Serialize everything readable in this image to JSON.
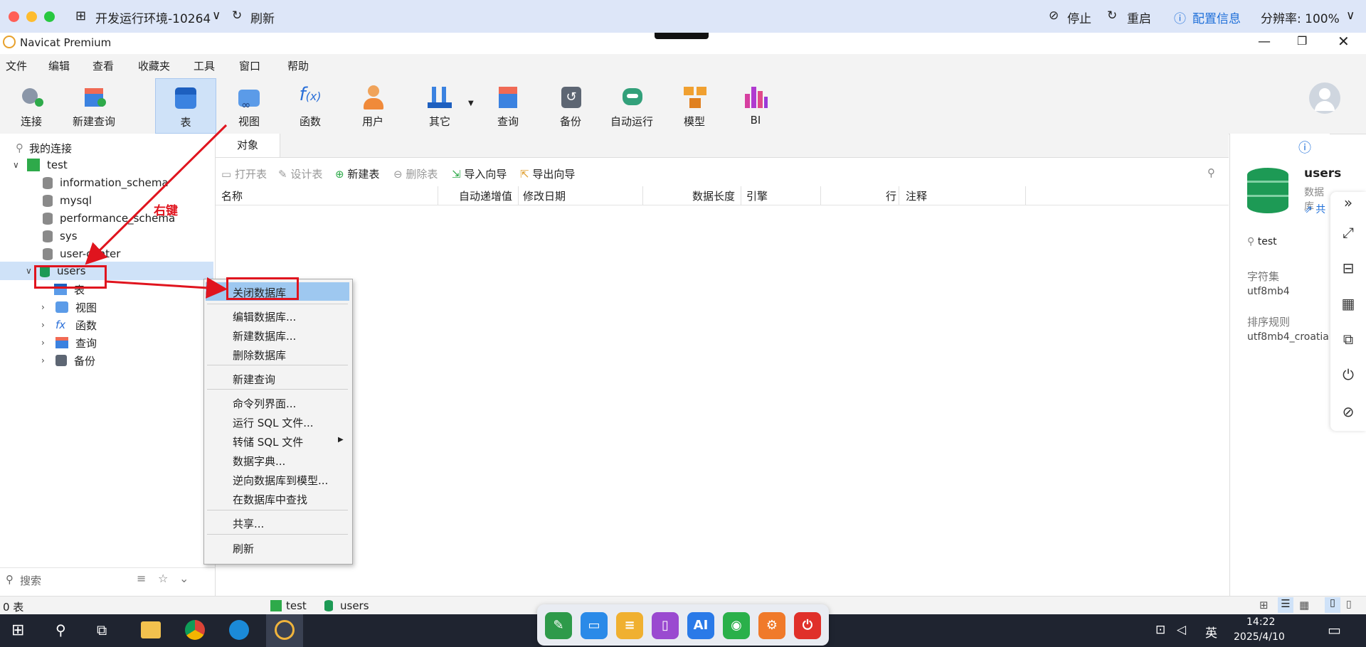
{
  "remote_bar": {
    "env_label": "开发运行环境-10264",
    "refresh": "刷新",
    "stop": "停止",
    "restart": "重启",
    "config_info": "配置信息",
    "resolution": "分辨率: 100%"
  },
  "window": {
    "title": "Navicat Premium"
  },
  "menu": [
    "文件",
    "编辑",
    "查看",
    "收藏夹",
    "工具",
    "窗口",
    "帮助"
  ],
  "toolbar": [
    "连接",
    "新建查询",
    "表",
    "视图",
    "函数",
    "用户",
    "其它",
    "查询",
    "备份",
    "自动运行",
    "模型",
    "BI"
  ],
  "tree": {
    "root": "我的连接",
    "connection": "test",
    "databases": [
      "information_schema",
      "mysql",
      "performance_schema",
      "sys",
      "user-center",
      "users"
    ],
    "users_children": [
      "表",
      "视图",
      "函数",
      "查询",
      "备份"
    ],
    "search_placeholder": "搜索"
  },
  "center": {
    "tab": "对象",
    "actions": [
      "打开表",
      "设计表",
      "新建表",
      "删除表",
      "导入向导",
      "导出向导"
    ],
    "columns": [
      "名称",
      "自动递增值",
      "修改日期",
      "数据长度",
      "引擎",
      "行",
      "注释"
    ]
  },
  "info": {
    "name": "users",
    "type": "数据库",
    "share": "共",
    "connection": "test",
    "charset_label": "字符集",
    "charset": "utf8mb4",
    "collation_label": "排序规则",
    "collation": "utf8mb4_croatia"
  },
  "context_menu": {
    "items": [
      "关闭数据库",
      "编辑数据库...",
      "新建数据库...",
      "删除数据库",
      "新建查询",
      "命令列界面...",
      "运行 SQL 文件...",
      "转储 SQL 文件",
      "数据字典...",
      "逆向数据库到模型...",
      "在数据库中查找",
      "共享...",
      "刷新"
    ]
  },
  "annotation": {
    "right_click": "右键"
  },
  "status": {
    "count": "0 表",
    "conn": "test",
    "db": "users"
  },
  "taskbar": {
    "time": "14:22",
    "date": "2025/4/10",
    "ime": "英"
  },
  "colors": {
    "accent": "#1e6fd9",
    "red": "#e0141e",
    "green": "#1d9a55"
  }
}
